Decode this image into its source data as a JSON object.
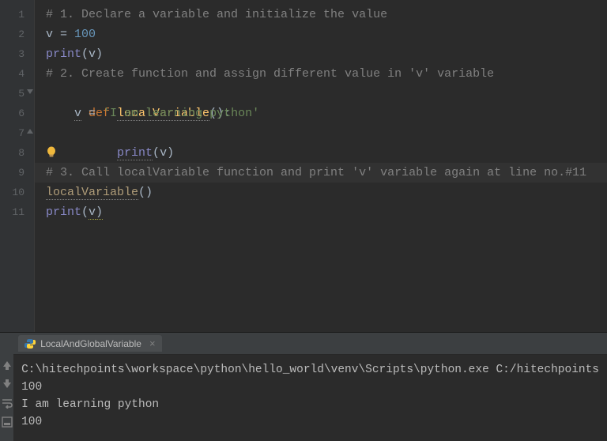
{
  "gutter": {
    "lines": [
      "1",
      "2",
      "3",
      "4",
      "5",
      "6",
      "7",
      "8",
      "9",
      "10",
      "11"
    ]
  },
  "code": {
    "l1": {
      "comment": "# 1. Declare a variable and initialize the value"
    },
    "l2": {
      "var": "v",
      "op": " = ",
      "num": "100"
    },
    "l3": {
      "fn": "print",
      "paren_open": "(",
      "arg": "v",
      "paren_close": ")"
    },
    "l4": {
      "comment": "# 2. Create function and assign different value in 'v' variable"
    },
    "l5": {
      "kw": "def ",
      "fn": "localVariable",
      "parens": "()",
      "colon": ":"
    },
    "l6": {
      "indent": "    ",
      "var": "v",
      "op": " = ",
      "str": "'I am learning python'"
    },
    "l7": {
      "indent": "    ",
      "fn": "print",
      "paren_open": "(",
      "arg": "v",
      "paren_close": ")"
    },
    "l9": {
      "comment": "# 3. Call localVariable function and print 'v' variable again at line no.#11"
    },
    "l10": {
      "fn": "localVariable",
      "parens": "()"
    },
    "l11": {
      "fn": "print",
      "paren_open": "(",
      "arg": "v",
      "paren_close": ")"
    }
  },
  "terminal": {
    "tab_label": "LocalAndGlobalVariable",
    "out_line1": "C:\\hitechpoints\\workspace\\python\\hello_world\\venv\\Scripts\\python.exe C:/hitechpoints",
    "out_line2": "100",
    "out_line3": "I am learning python",
    "out_line4": "100"
  }
}
